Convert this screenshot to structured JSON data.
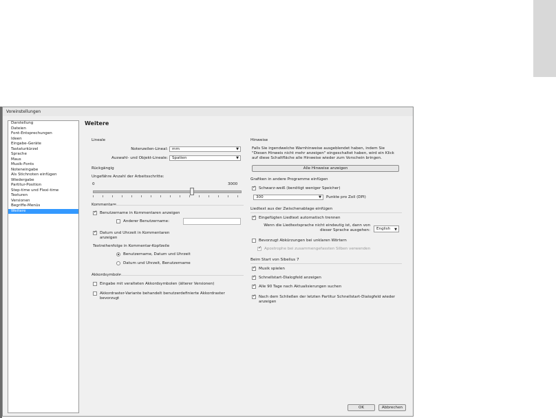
{
  "window_title": "Voreinstellungen",
  "categories": [
    "Darstellung",
    "Dateien",
    "Font-Entsprechungen",
    "Ideen",
    "Eingabe-Geräte",
    "Tastaturkürzel",
    "Sprache",
    "Maus",
    "Musik-Fonts",
    "Noteneingabe",
    "Als Stichnoten einfügen",
    "Wiedergabe",
    "Partitur-Position",
    "Step-time und Flexi-time",
    "Texturen",
    "Versionen",
    "Begriffe-Menüs",
    "Weitere"
  ],
  "selected_category": "Weitere",
  "page_title": "Weitere",
  "lineale": {
    "heading": "Lineale",
    "notenzeilen_label": "Notenzeilen-Lineal:",
    "notenzeilen_value": "mm",
    "auswahl_label": "Auswahl- und Objekt-Lineale:",
    "auswahl_value": "Spatien"
  },
  "rueckgaengig": {
    "heading": "Rückgängig",
    "label": "Ungefähre Anzahl der Arbeitsschritte:",
    "min": "0",
    "max": "3000",
    "slider_value": 2000
  },
  "kommentare": {
    "heading": "Kommentare",
    "show_username": "Benutzername in Kommentaren anzeigen",
    "show_username_checked": true,
    "other_username": "Anderer Benutzername:",
    "other_username_checked": false,
    "other_username_value": "",
    "datetime": "Datum und Uhrzeit in Kommentaren anzeigen",
    "datetime_checked": true,
    "order_heading": "Textreihenfolge in Kommentar-Kopfzeile",
    "order_1": "Benutzername, Datum und Uhrzeit",
    "order_2": "Datum und Uhrzeit, Benutzername",
    "order_selected": 1
  },
  "akkordsymbole": {
    "heading": "Akkordsymbole",
    "old_input": "Eingabe mit veralteten Akkordsymbolen (älterer Versionen)",
    "old_input_checked": false,
    "user_defined": "Akkordraster-Variante behandelt benutzerdefinierte Akkordraster bevorzugt",
    "user_defined_checked": false
  },
  "hinweise": {
    "heading": "Hinweise",
    "text": "Falls Sie irgendwelche Warnhinweise ausgeblendet haben, indem Sie \"Diesen Hinweis nicht mehr anzeigen\" eingeschaltet haben, wird ein Klick auf diese Schaltfläche alle Hinweise wieder zum Vorschein bringen.",
    "button": "Alle Hinweise anzeigen"
  },
  "grafiken": {
    "heading": "Grafiken in andere Programme einfügen",
    "bw": "Schwarz-weiß (benötigt weniger Speicher)",
    "bw_checked": true,
    "dpi_value": "300",
    "dpi_label": "Punkte pro Zoll (DPI)"
  },
  "liedtext": {
    "heading": "Liedtext aus der Zwischenablage einfügen",
    "auto_split": "Eingefügten Liedtext automatisch trennen",
    "auto_split_checked": true,
    "lang_label": "Wenn die Liedtextsprache nicht eindeutig ist, dann von dieser Sprache ausgehen:",
    "lang_value": "English",
    "prefer_abbr": "Bevorzugt Abkürzungen bei unklaren Wörtern",
    "prefer_abbr_checked": false,
    "apostrophe": "Apostrophe bei zusammengefassten Silben verwenden",
    "apostrophe_checked": true
  },
  "start": {
    "heading": "Beim Start von Sibelius 7",
    "music": "Musik spielen",
    "music_checked": true,
    "quickstart": "Schnellstart-Dialogfeld anzeigen",
    "quickstart_checked": true,
    "updates": "Alle 90 Tage nach Aktualisierungen suchen",
    "updates_checked": true,
    "reopen": "Nach dem Schließen der letzten Partitur Schnellstart-Dialogfeld wieder anzeigen",
    "reopen_checked": true
  },
  "buttons": {
    "ok": "OK",
    "cancel": "Abbrechen"
  }
}
